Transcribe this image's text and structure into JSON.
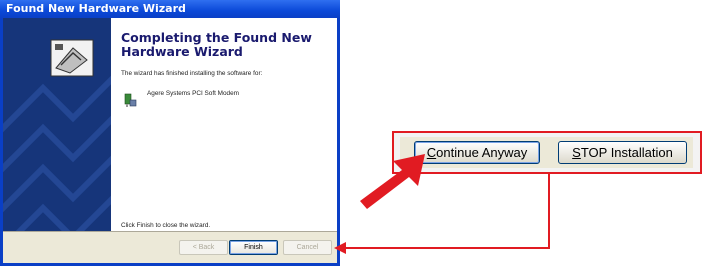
{
  "window": {
    "title": "Found New Hardware Wizard"
  },
  "wizard": {
    "heading": "Completing the Found New Hardware Wizard",
    "description": "The wizard has finished installing the software for:",
    "device_name": "Agere Systems PCI Soft Modem",
    "finish_note": "Click Finish to close the wizard.",
    "buttons": {
      "back": "< Back",
      "finish": "Finish",
      "cancel": "Cancel"
    }
  },
  "callout": {
    "continue_label_mnemonic": "C",
    "continue_label_rest": "ontinue Anyway",
    "stop_label_mnemonic": "S",
    "stop_label_rest": "TOP Installation"
  },
  "colors": {
    "annotation_red": "#e11b22",
    "title_blue": "#0a3fc6"
  }
}
